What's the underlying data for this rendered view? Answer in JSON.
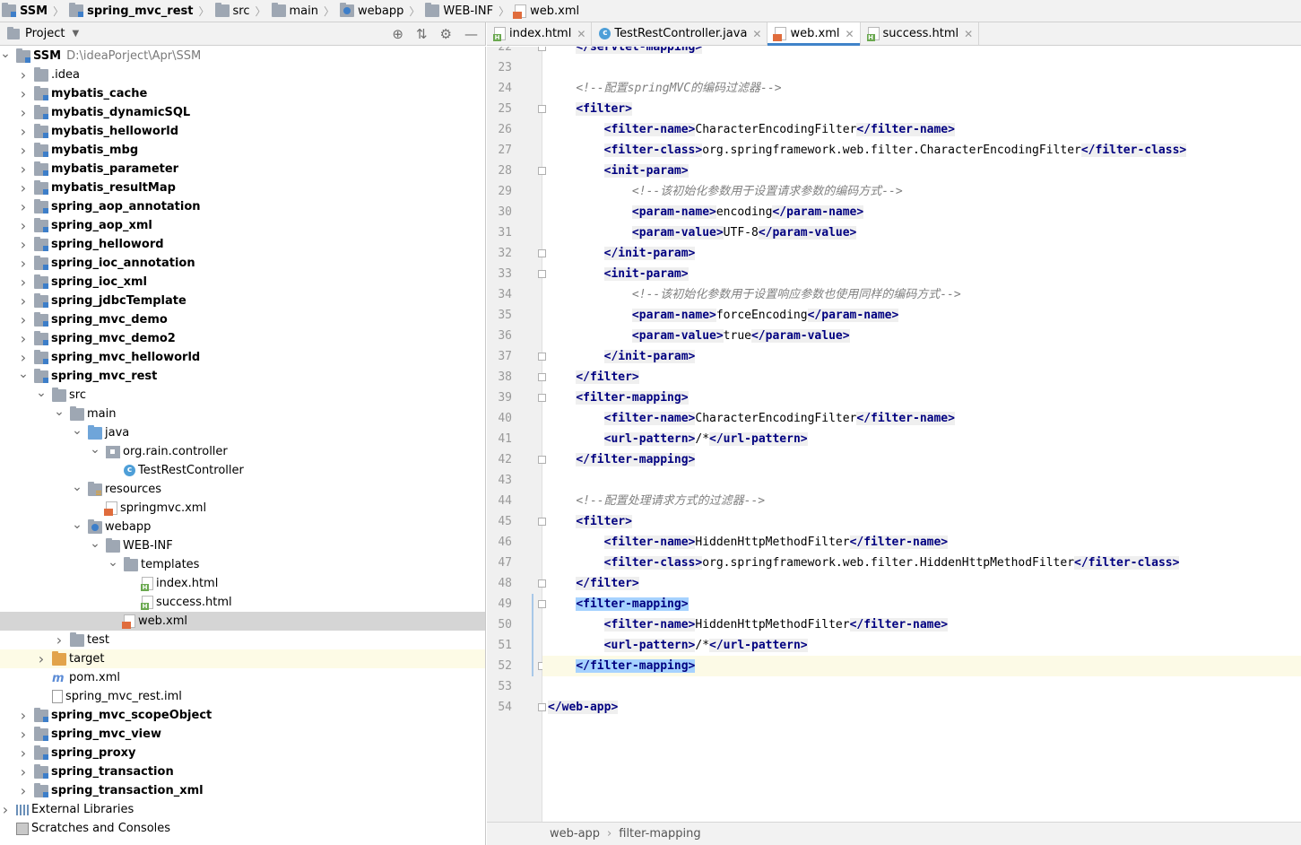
{
  "breadcrumb": [
    {
      "label": "SSM",
      "icon": "module-icon",
      "bold": true
    },
    {
      "label": "spring_mvc_rest",
      "icon": "module-icon",
      "bold": true
    },
    {
      "label": "src",
      "icon": "folder-icon",
      "bold": false
    },
    {
      "label": "main",
      "icon": "folder-icon",
      "bold": false
    },
    {
      "label": "webapp",
      "icon": "web-folder-icon",
      "bold": false
    },
    {
      "label": "WEB-INF",
      "icon": "folder-icon",
      "bold": false
    },
    {
      "label": "web.xml",
      "icon": "xml-file-icon",
      "bold": false
    }
  ],
  "project_panel": {
    "title": "Project",
    "tools": [
      "locate-icon",
      "collapse-icon",
      "gear-icon",
      "hide-icon"
    ]
  },
  "tree": [
    {
      "label": "SSM",
      "path": "D:\\ideaPorject\\Apr\\SSM",
      "depth": 0,
      "arrow": "down",
      "icon": "module",
      "bold": true
    },
    {
      "label": ".idea",
      "depth": 1,
      "arrow": "right",
      "icon": "folder",
      "bold": false
    },
    {
      "label": "mybatis_cache",
      "depth": 1,
      "arrow": "right",
      "icon": "module",
      "bold": true
    },
    {
      "label": "mybatis_dynamicSQL",
      "depth": 1,
      "arrow": "right",
      "icon": "module",
      "bold": true
    },
    {
      "label": "mybatis_helloworld",
      "depth": 1,
      "arrow": "right",
      "icon": "module",
      "bold": true
    },
    {
      "label": "mybatis_mbg",
      "depth": 1,
      "arrow": "right",
      "icon": "module",
      "bold": true
    },
    {
      "label": "mybatis_parameter",
      "depth": 1,
      "arrow": "right",
      "icon": "module",
      "bold": true
    },
    {
      "label": "mybatis_resultMap",
      "depth": 1,
      "arrow": "right",
      "icon": "module",
      "bold": true
    },
    {
      "label": "spring_aop_annotation",
      "depth": 1,
      "arrow": "right",
      "icon": "module",
      "bold": true
    },
    {
      "label": "spring_aop_xml",
      "depth": 1,
      "arrow": "right",
      "icon": "module",
      "bold": true
    },
    {
      "label": "spring_helloword",
      "depth": 1,
      "arrow": "right",
      "icon": "module",
      "bold": true
    },
    {
      "label": "spring_ioc_annotation",
      "depth": 1,
      "arrow": "right",
      "icon": "module",
      "bold": true
    },
    {
      "label": "spring_ioc_xml",
      "depth": 1,
      "arrow": "right",
      "icon": "module",
      "bold": true
    },
    {
      "label": "spring_jdbcTemplate",
      "depth": 1,
      "arrow": "right",
      "icon": "module",
      "bold": true
    },
    {
      "label": "spring_mvc_demo",
      "depth": 1,
      "arrow": "right",
      "icon": "module",
      "bold": true
    },
    {
      "label": "spring_mvc_demo2",
      "depth": 1,
      "arrow": "right",
      "icon": "module",
      "bold": true
    },
    {
      "label": "spring_mvc_helloworld",
      "depth": 1,
      "arrow": "right",
      "icon": "module",
      "bold": true
    },
    {
      "label": "spring_mvc_rest",
      "depth": 1,
      "arrow": "down",
      "icon": "module",
      "bold": true
    },
    {
      "label": "src",
      "depth": 2,
      "arrow": "down",
      "icon": "folder",
      "bold": false
    },
    {
      "label": "main",
      "depth": 3,
      "arrow": "down",
      "icon": "folder",
      "bold": false
    },
    {
      "label": "java",
      "depth": 4,
      "arrow": "down",
      "icon": "blue-folder",
      "bold": false
    },
    {
      "label": "org.rain.controller",
      "depth": 5,
      "arrow": "down",
      "icon": "package",
      "bold": false
    },
    {
      "label": "TestRestController",
      "depth": 6,
      "arrow": "",
      "icon": "class",
      "bold": false
    },
    {
      "label": "resources",
      "depth": 4,
      "arrow": "down",
      "icon": "res-folder",
      "bold": false
    },
    {
      "label": "springmvc.xml",
      "depth": 5,
      "arrow": "",
      "icon": "xml",
      "bold": false
    },
    {
      "label": "webapp",
      "depth": 4,
      "arrow": "down",
      "icon": "web-folder",
      "bold": false
    },
    {
      "label": "WEB-INF",
      "depth": 5,
      "arrow": "down",
      "icon": "folder",
      "bold": false
    },
    {
      "label": "templates",
      "depth": 6,
      "arrow": "down",
      "icon": "folder",
      "bold": false
    },
    {
      "label": "index.html",
      "depth": 7,
      "arrow": "",
      "icon": "html",
      "bold": false
    },
    {
      "label": "success.html",
      "depth": 7,
      "arrow": "",
      "icon": "html",
      "bold": false
    },
    {
      "label": "web.xml",
      "depth": 6,
      "arrow": "",
      "icon": "xml",
      "bold": false,
      "selected": true
    },
    {
      "label": "test",
      "depth": 3,
      "arrow": "right",
      "icon": "folder",
      "bold": false
    },
    {
      "label": "target",
      "depth": 2,
      "arrow": "right",
      "icon": "orange-folder",
      "bold": false,
      "excluded": true
    },
    {
      "label": "pom.xml",
      "depth": 2,
      "arrow": "",
      "icon": "pom",
      "bold": false
    },
    {
      "label": "spring_mvc_rest.iml",
      "depth": 2,
      "arrow": "",
      "icon": "iml",
      "bold": false
    },
    {
      "label": "spring_mvc_scopeObject",
      "depth": 1,
      "arrow": "right",
      "icon": "module",
      "bold": true
    },
    {
      "label": "spring_mvc_view",
      "depth": 1,
      "arrow": "right",
      "icon": "module",
      "bold": true
    },
    {
      "label": "spring_proxy",
      "depth": 1,
      "arrow": "right",
      "icon": "module",
      "bold": true
    },
    {
      "label": "spring_transaction",
      "depth": 1,
      "arrow": "right",
      "icon": "module",
      "bold": true
    },
    {
      "label": "spring_transaction_xml",
      "depth": 1,
      "arrow": "right",
      "icon": "module",
      "bold": true
    },
    {
      "label": "External Libraries",
      "depth": 0,
      "arrow": "right",
      "icon": "lib",
      "bold": false
    },
    {
      "label": "Scratches and Consoles",
      "depth": 0,
      "arrow": "",
      "icon": "scratch",
      "bold": false
    }
  ],
  "tabs": [
    {
      "label": "index.html",
      "icon": "html",
      "active": false
    },
    {
      "label": "TestRestController.java",
      "icon": "class",
      "active": false
    },
    {
      "label": "web.xml",
      "icon": "xml",
      "active": true
    },
    {
      "label": "success.html",
      "icon": "html",
      "active": false
    }
  ],
  "tab_close_glyph": "✕",
  "editor": {
    "lines": [
      {
        "n": "22",
        "parts": [
          [
            "i",
            "    "
          ],
          [
            "t",
            "</servlet-mapping>"
          ]
        ],
        "fold": true
      },
      {
        "n": "23",
        "parts": []
      },
      {
        "n": "24",
        "parts": [
          [
            "i",
            "    "
          ],
          [
            "c",
            "<!--配置springMVC的编码过滤器-->"
          ]
        ]
      },
      {
        "n": "25",
        "parts": [
          [
            "i",
            "    "
          ],
          [
            "t",
            "<filter>"
          ]
        ],
        "fold": true
      },
      {
        "n": "26",
        "parts": [
          [
            "i",
            "        "
          ],
          [
            "t",
            "<filter-name>"
          ],
          [
            "x",
            "CharacterEncodingFilter"
          ],
          [
            "t",
            "</filter-name>"
          ]
        ]
      },
      {
        "n": "27",
        "parts": [
          [
            "i",
            "        "
          ],
          [
            "t",
            "<filter-class>"
          ],
          [
            "x",
            "org.springframework.web.filter.CharacterEncodingFilter"
          ],
          [
            "t",
            "</filter-class>"
          ]
        ]
      },
      {
        "n": "28",
        "parts": [
          [
            "i",
            "        "
          ],
          [
            "t",
            "<init-param>"
          ]
        ],
        "fold": true
      },
      {
        "n": "29",
        "parts": [
          [
            "i",
            "            "
          ],
          [
            "c",
            "<!--该初始化参数用于设置请求参数的编码方式-->"
          ]
        ]
      },
      {
        "n": "30",
        "parts": [
          [
            "i",
            "            "
          ],
          [
            "t",
            "<param-name>"
          ],
          [
            "x",
            "encoding"
          ],
          [
            "t",
            "</param-name>"
          ]
        ]
      },
      {
        "n": "31",
        "parts": [
          [
            "i",
            "            "
          ],
          [
            "t",
            "<param-value>"
          ],
          [
            "x",
            "UTF-8"
          ],
          [
            "t",
            "</param-value>"
          ]
        ]
      },
      {
        "n": "32",
        "parts": [
          [
            "i",
            "        "
          ],
          [
            "t",
            "</init-param>"
          ]
        ],
        "fold": true
      },
      {
        "n": "33",
        "parts": [
          [
            "i",
            "        "
          ],
          [
            "t",
            "<init-param>"
          ]
        ],
        "fold": true
      },
      {
        "n": "34",
        "parts": [
          [
            "i",
            "            "
          ],
          [
            "c",
            "<!--该初始化参数用于设置响应参数也使用同样的编码方式-->"
          ]
        ]
      },
      {
        "n": "35",
        "parts": [
          [
            "i",
            "            "
          ],
          [
            "t",
            "<param-name>"
          ],
          [
            "x",
            "forceEncoding"
          ],
          [
            "t",
            "</param-name>"
          ]
        ]
      },
      {
        "n": "36",
        "parts": [
          [
            "i",
            "            "
          ],
          [
            "t",
            "<param-value>"
          ],
          [
            "x",
            "true"
          ],
          [
            "t",
            "</param-value>"
          ]
        ]
      },
      {
        "n": "37",
        "parts": [
          [
            "i",
            "        "
          ],
          [
            "t",
            "</init-param>"
          ]
        ],
        "fold": true
      },
      {
        "n": "38",
        "parts": [
          [
            "i",
            "    "
          ],
          [
            "t",
            "</filter>"
          ]
        ],
        "fold": true
      },
      {
        "n": "39",
        "parts": [
          [
            "i",
            "    "
          ],
          [
            "t",
            "<filter-mapping>"
          ]
        ],
        "fold": true
      },
      {
        "n": "40",
        "parts": [
          [
            "i",
            "        "
          ],
          [
            "t",
            "<filter-name>"
          ],
          [
            "x",
            "CharacterEncodingFilter"
          ],
          [
            "t",
            "</filter-name>"
          ]
        ]
      },
      {
        "n": "41",
        "parts": [
          [
            "i",
            "        "
          ],
          [
            "t",
            "<url-pattern>"
          ],
          [
            "x",
            "/*"
          ],
          [
            "t",
            "</url-pattern>"
          ]
        ]
      },
      {
        "n": "42",
        "parts": [
          [
            "i",
            "    "
          ],
          [
            "t",
            "</filter-mapping>"
          ]
        ],
        "fold": true
      },
      {
        "n": "43",
        "parts": []
      },
      {
        "n": "44",
        "parts": [
          [
            "i",
            "    "
          ],
          [
            "c",
            "<!--配置处理请求方式的过滤器-->"
          ]
        ]
      },
      {
        "n": "45",
        "parts": [
          [
            "i",
            "    "
          ],
          [
            "t",
            "<filter>"
          ]
        ],
        "fold": true
      },
      {
        "n": "46",
        "parts": [
          [
            "i",
            "        "
          ],
          [
            "t",
            "<filter-name>"
          ],
          [
            "x",
            "HiddenHttpMethodFilter"
          ],
          [
            "t",
            "</filter-name>"
          ]
        ]
      },
      {
        "n": "47",
        "parts": [
          [
            "i",
            "        "
          ],
          [
            "t",
            "<filter-class>"
          ],
          [
            "x",
            "org.springframework.web.filter.HiddenHttpMethodFilter"
          ],
          [
            "t",
            "</filter-class>"
          ]
        ]
      },
      {
        "n": "48",
        "parts": [
          [
            "i",
            "    "
          ],
          [
            "t",
            "</filter>"
          ]
        ],
        "fold": true
      },
      {
        "n": "49",
        "parts": [
          [
            "i",
            "    "
          ],
          [
            "h",
            "<filter-mapping>"
          ]
        ],
        "fold": true
      },
      {
        "n": "50",
        "parts": [
          [
            "i",
            "        "
          ],
          [
            "t",
            "<filter-name>"
          ],
          [
            "x",
            "HiddenHttpMethodFilter"
          ],
          [
            "t",
            "</filter-name>"
          ]
        ]
      },
      {
        "n": "51",
        "parts": [
          [
            "i",
            "        "
          ],
          [
            "t",
            "<url-pattern>"
          ],
          [
            "x",
            "/*"
          ],
          [
            "t",
            "</url-pattern>"
          ]
        ]
      },
      {
        "n": "52",
        "parts": [
          [
            "i",
            "    "
          ],
          [
            "h",
            "</filter-mapping>"
          ]
        ],
        "fold": true,
        "current": true
      },
      {
        "n": "53",
        "parts": []
      },
      {
        "n": "54",
        "parts": [
          [
            "t",
            "</web-app>"
          ]
        ],
        "fold": true
      }
    ]
  },
  "status_breadcrumb": [
    "web-app",
    "filter-mapping"
  ],
  "colors": {
    "tag": "#000080",
    "comment": "#808080",
    "selection": "#a6d2ff",
    "current_line": "#fcfae6",
    "accent": "#4083c9"
  }
}
